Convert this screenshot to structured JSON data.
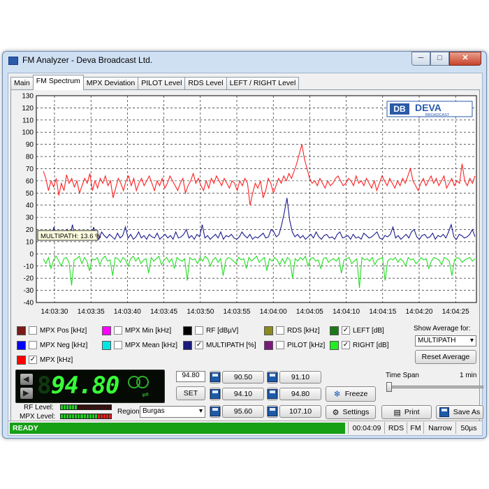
{
  "window": {
    "title": "FM Analyzer - Deva Broadcast Ltd.",
    "min": "─",
    "max": "□",
    "close": "✕"
  },
  "tabs": [
    "Main",
    "FM Spectrum",
    "MPX Deviation",
    "PILOT Level",
    "RDS Level",
    "LEFT / RIGHT Level"
  ],
  "active_tab": "FM Spectrum",
  "logo": {
    "text": "DEVA",
    "sub": "BROADCAST",
    "mark": "DB"
  },
  "tooltip": "MULTIPATH: 13.6 %",
  "chart_data": {
    "type": "line",
    "y_ticks": [
      130,
      120,
      110,
      100,
      90,
      80,
      70,
      60,
      50,
      40,
      30,
      20,
      10,
      0,
      -10,
      -20,
      -30,
      -40
    ],
    "ylim": [
      -40,
      130
    ],
    "x_ticks": [
      "14:03:30",
      "14:03:35",
      "14:03:40",
      "14:03:45",
      "14:03:50",
      "14:03:55",
      "14:04:00",
      "14:04:05",
      "14:04:10",
      "14:04:15",
      "14:04:20",
      "14:04:25"
    ],
    "grid": true,
    "series": [
      {
        "name": "LEFT [dB]",
        "color": "#ff2020",
        "values": [
          68,
          62,
          52,
          60,
          55,
          62,
          48,
          58,
          52,
          65,
          58,
          62,
          55,
          60,
          50,
          56,
          62,
          58,
          66,
          52,
          60,
          54,
          62,
          58,
          64,
          56,
          60,
          46,
          54,
          62,
          58,
          52,
          60,
          64,
          56,
          62,
          52,
          58,
          62,
          56,
          60,
          64,
          58,
          52,
          60,
          56,
          62,
          54,
          58,
          64,
          60,
          56,
          52,
          58,
          62,
          50,
          56,
          60,
          66,
          58,
          62,
          56,
          52,
          60,
          54,
          62,
          58,
          64,
          60,
          56,
          62,
          58,
          54,
          60,
          58,
          52,
          60,
          56,
          62,
          58,
          40,
          50,
          58,
          54,
          60,
          46,
          52,
          62,
          58,
          50,
          56,
          62,
          58,
          64,
          60,
          66,
          62,
          68,
          74,
          82,
          90,
          78,
          70,
          62,
          58,
          60,
          56,
          62,
          58,
          54,
          60,
          56,
          58,
          62,
          64,
          60,
          56,
          58,
          62,
          60,
          56,
          64,
          58,
          60,
          56,
          62,
          58,
          54,
          60,
          52,
          58,
          64,
          60,
          56,
          62,
          58,
          54,
          60,
          56,
          62,
          58,
          64,
          70,
          60,
          56,
          52,
          58,
          62,
          56,
          60,
          64,
          58,
          62,
          56,
          60,
          64,
          54,
          58,
          62,
          56,
          60,
          58,
          74,
          60,
          56,
          62,
          58,
          64
        ]
      },
      {
        "name": "MULTIPATH [%]",
        "color": "#1a1a8c",
        "values": [
          16,
          12,
          18,
          14,
          22,
          12,
          16,
          14,
          13,
          20,
          14,
          24,
          13,
          15,
          18,
          12,
          14,
          16,
          13,
          22,
          14,
          12,
          18,
          15,
          13,
          16,
          14,
          12,
          17,
          13,
          15,
          22,
          13,
          16,
          12,
          14,
          18,
          13,
          15,
          12,
          16,
          14,
          13,
          17,
          12,
          14,
          16,
          13,
          15,
          12,
          18,
          13,
          14,
          16,
          20,
          13,
          15,
          12,
          16,
          14,
          24,
          13,
          15,
          12,
          14,
          16,
          13,
          18,
          12,
          15,
          14,
          16,
          13,
          12,
          14,
          18,
          15,
          13,
          16,
          12,
          14,
          13,
          15,
          17,
          13,
          14,
          20,
          18,
          14,
          16,
          24,
          34,
          46,
          28,
          18,
          14,
          16,
          13,
          15,
          12,
          14,
          16,
          13,
          18,
          14,
          12,
          15,
          16,
          13,
          14,
          12,
          16,
          18,
          13,
          14,
          15,
          12,
          16,
          13,
          14,
          12,
          17,
          15,
          13,
          14,
          16,
          18,
          13,
          12,
          15,
          14,
          16,
          22,
          13,
          15,
          12,
          14,
          16,
          13,
          18,
          20,
          14,
          12,
          15,
          16,
          13,
          14,
          17,
          12,
          15,
          14,
          16,
          13,
          18,
          24,
          14,
          12,
          16,
          15,
          13,
          14,
          16,
          20,
          14
        ]
      },
      {
        "name": "MPX [kHz]",
        "color": "#22dd22",
        "values": [
          -4,
          -8,
          -3,
          -12,
          -5,
          -2,
          -6,
          -10,
          -4,
          -3,
          -7,
          -26,
          -5,
          -4,
          -2,
          -8,
          -3,
          -6,
          -14,
          -4,
          -5,
          -3,
          -9,
          -4,
          -2,
          -6,
          -5,
          -18,
          -3,
          -4,
          -7,
          -3,
          -5,
          -10,
          -4,
          -2,
          -6,
          -3,
          -8,
          -5,
          -4,
          -16,
          -3,
          -6,
          -4,
          -2,
          -9,
          -5,
          -3,
          -7,
          -4,
          -12,
          -3,
          -5,
          -6,
          -4,
          -22,
          -3,
          -5,
          -4,
          -8,
          -3,
          -6,
          -2,
          -4,
          -10,
          -5,
          -3,
          -7,
          -4,
          -18,
          -5,
          -3,
          -4,
          -6,
          -8,
          -3,
          -5,
          -4,
          -12,
          -3,
          -6,
          -4,
          -2,
          -7,
          -5,
          -3,
          -14,
          -4,
          -6,
          -3,
          -5,
          -9,
          -4,
          -8,
          -3,
          -5,
          -20,
          -4,
          -6,
          -3,
          -5,
          -2,
          -10,
          -4,
          -3,
          -6,
          -5,
          -12,
          -4,
          -3,
          -7,
          -5,
          -4,
          -6,
          -3,
          -16,
          -5,
          -4,
          -3,
          -8,
          -6,
          -4,
          -28,
          -3,
          -5,
          -4,
          -6,
          -3,
          -9,
          -5,
          -4,
          -3,
          -22,
          -6,
          -4,
          -5,
          -3,
          -7,
          -4,
          -6,
          -10,
          -3,
          -5,
          -4,
          -8,
          -6,
          -3,
          -5,
          -4,
          -12,
          -6,
          -3,
          -4,
          -5,
          -9,
          -3,
          -4,
          -6,
          -18,
          -5,
          -3,
          -4,
          -7,
          -5,
          -4,
          -3,
          -6,
          -4
        ]
      }
    ]
  },
  "legend": [
    {
      "label": "MPX Pos [kHz]",
      "color": "#7a1a1a",
      "checked": false
    },
    {
      "label": "MPX Min [kHz]",
      "color": "#ff00ff",
      "checked": false
    },
    {
      "label": "RF [dBµV]",
      "color": "#000000",
      "checked": false
    },
    {
      "label": "RDS [kHz]",
      "color": "#8a8a1e",
      "checked": false
    },
    {
      "label": "LEFT [dB]",
      "color": "#1a7a1a",
      "checked": true
    },
    {
      "label": "MPX Neg [kHz]",
      "color": "#0000ff",
      "checked": false
    },
    {
      "label": "MPX Mean [kHz]",
      "color": "#00e5e5",
      "checked": false
    },
    {
      "label": "MULTIPATH [%]",
      "color": "#1a1a7a",
      "checked": true
    },
    {
      "label": "PILOT [kHz]",
      "color": "#7a1a7a",
      "checked": false
    },
    {
      "label": "RIGHT [dB]",
      "color": "#22ee22",
      "checked": true
    },
    {
      "label": "MPX [kHz]",
      "color": "#ff0000",
      "checked": true
    }
  ],
  "check_mark": "✓",
  "show_average": {
    "label": "Show Average for:",
    "value": "MULTIPATH",
    "reset": "Reset Average"
  },
  "display": {
    "freq": "94.80",
    "ghost": "8"
  },
  "controls": {
    "freq_value": "94.80",
    "set": "SET",
    "presets": [
      "90.50",
      "91.10",
      "94.10",
      "94.80",
      "95.60",
      "107.10"
    ],
    "freeze": "Freeze",
    "settings": "Settings",
    "print": "Print",
    "save_as": "Save As",
    "time_span": "Time Span",
    "time_span_value": "1 min",
    "rf_level": "RF Level:",
    "mpx_level": "MPX Level:",
    "region_label": "Region",
    "region_value": "Burgas"
  },
  "status": {
    "ready": "READY",
    "time": "00:04:09",
    "rds": "RDS",
    "fm": "FM",
    "narrow": "Narrow",
    "deemph": "50µs"
  }
}
